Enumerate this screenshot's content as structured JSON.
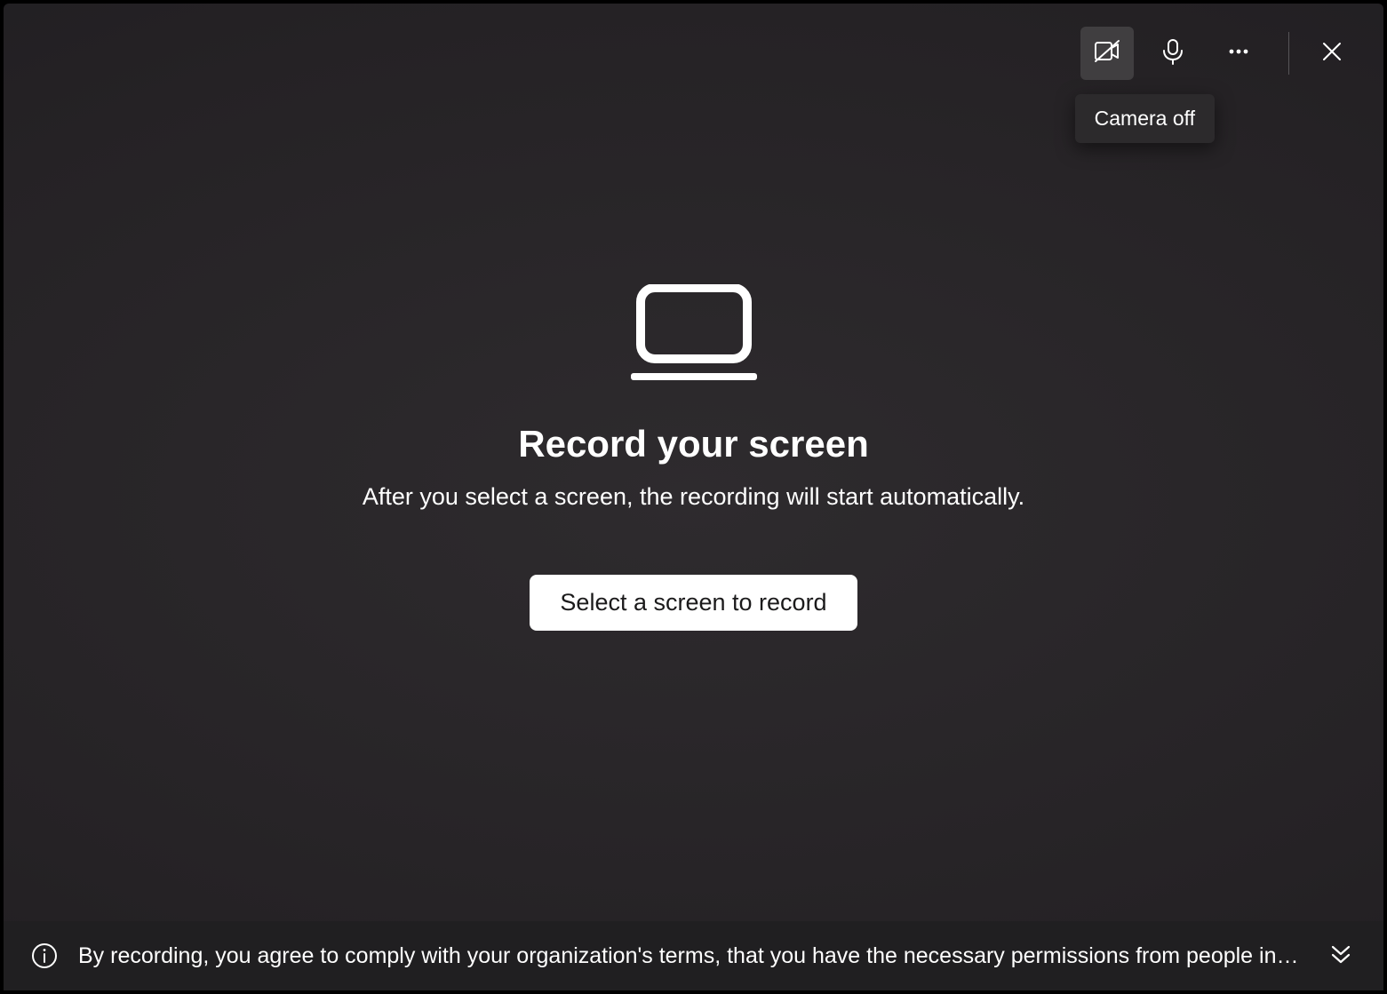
{
  "toolbar": {
    "camera_tooltip": "Camera off"
  },
  "main": {
    "heading": "Record your screen",
    "subheading": "After you select a screen, the recording will start automatically.",
    "cta_label": "Select a screen to record"
  },
  "info_bar": {
    "message": "By recording, you agree to comply with your organization's terms, that you have the necessary permissions from people in your vi…"
  }
}
